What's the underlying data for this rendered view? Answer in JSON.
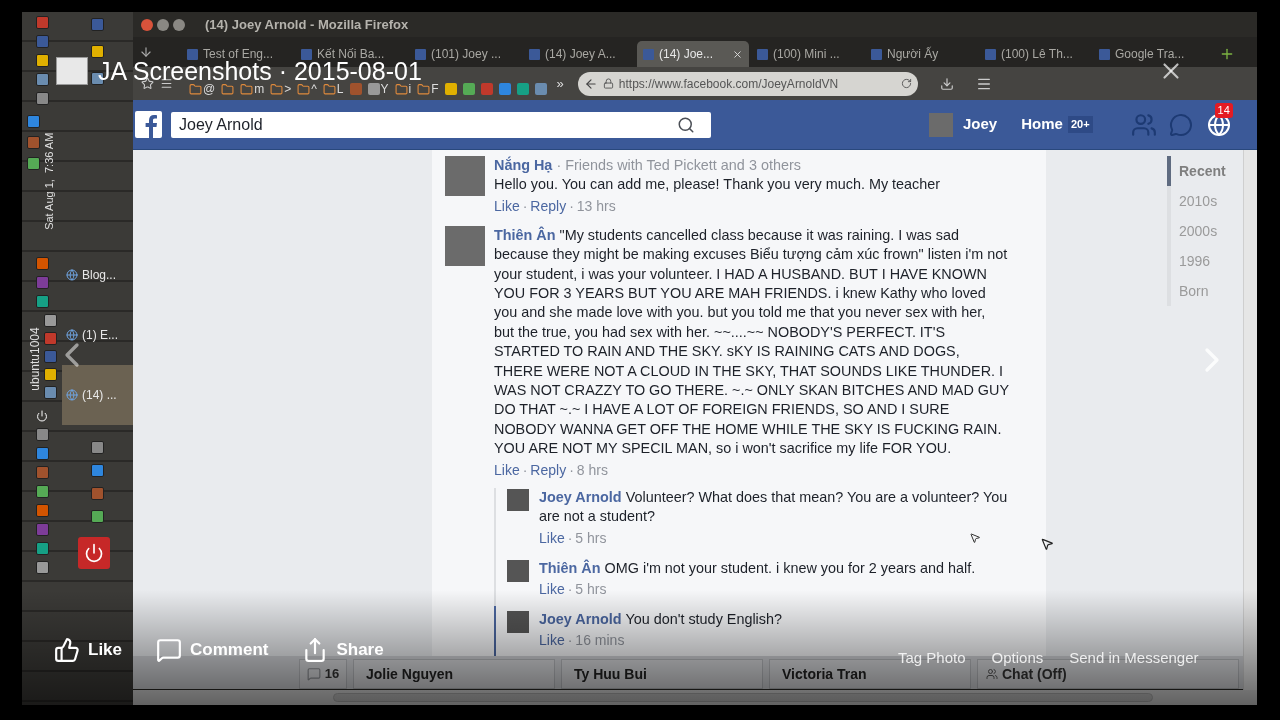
{
  "viewer": {
    "album_title": "JA Screenshots · 2015-08-01",
    "actions": [
      "Like",
      "Comment",
      "Share"
    ],
    "photo_actions": [
      "Tag Photo",
      "Options",
      "Send in Messenger"
    ]
  },
  "desktop": {
    "clock": "Sat Aug 1,  7:36 AM",
    "hostname": "ubuntu1004",
    "tasks": [
      {
        "label": "Blog...",
        "selected": false
      },
      {
        "label": "(1) E...",
        "selected": false
      },
      {
        "label": "(14) ...",
        "selected": true
      }
    ]
  },
  "browser": {
    "title": "(14) Joey Arnold - Mozilla Firefox",
    "tabs": [
      {
        "label": "Test of Eng...",
        "selected": false
      },
      {
        "label": "Kết Nối Ba...",
        "selected": false
      },
      {
        "label": "(101) Joey ...",
        "selected": false
      },
      {
        "label": "(14) Joey A...",
        "selected": false
      },
      {
        "label": "(14) Joe...",
        "selected": true
      },
      {
        "label": "(100) Mini ...",
        "selected": false
      },
      {
        "label": "Người Ấy",
        "selected": false
      },
      {
        "label": "(100) Lê Th...",
        "selected": false
      },
      {
        "label": "Google Tra...",
        "selected": false
      }
    ],
    "bookmarks": [
      {
        "kind": "folder",
        "label": "@"
      },
      {
        "kind": "folder"
      },
      {
        "kind": "folder",
        "label": "m"
      },
      {
        "kind": "folder",
        "label": ">"
      },
      {
        "kind": "folder",
        "label": "^"
      },
      {
        "kind": "folder",
        "label": "L"
      },
      {
        "kind": "site"
      },
      {
        "kind": "site",
        "label": "Y"
      },
      {
        "kind": "folder",
        "label": "i"
      },
      {
        "kind": "folder",
        "label": "F"
      },
      {
        "kind": "site"
      },
      {
        "kind": "site"
      },
      {
        "kind": "site"
      },
      {
        "kind": "site"
      },
      {
        "kind": "site"
      },
      {
        "kind": "site"
      }
    ],
    "overflow": "»",
    "url": "https://www.facebook.com/JoeyArnoldVN"
  },
  "facebook": {
    "separator": "·",
    "search_value": "Joey Arnold",
    "profile_name": "Joey",
    "home": "Home",
    "home_count": "20+",
    "notifications": "14",
    "comments": [
      {
        "author": "Nắng Hạ",
        "subtitle": "Friends with Ted Pickett and 3 others",
        "text": "Hello you. You can add me, please! Thank you very much. My teacher",
        "actions": [
          "Like",
          "Reply"
        ],
        "time": "13 hrs"
      },
      {
        "author": "Thiên Ân",
        "text": "\"My students cancelled class because it was raining. I was sad because they might be making excuses Biểu tượng cảm xúc frown\" listen i'm not your student, i was your volunteer. I HAD A HUSBAND. BUT I HAVE KNOWN YOU FOR 3 YEARS BUT YOU ARE MAH FRIENDS. i knew Kathy who loved you and she made love with you. but you told me that you never sex with her, but the true, you had sex with her. ~~....~~ NOBODY'S PERFECT. IT'S STARTED TO RAIN AND THE SKY. sKY IS RAINING CATS AND DOGS, THERE WERE NOT A CLOUD IN THE SKY, THAT SOUNDS LIKE THUNDER. I WAS NOT CRAZZY TO GO THERE. ~.~ ONLY SKAN BITCHES AND MAD GUY DO THAT ~.~ I HAVE A LOT OF FOREIGN FRIENDS, SO AND I SURE NOBODY WANNA GET OFF THE HOME WHILE THE SKY IS FUCKING RAIN. YOU ARE NOT MY SPECIL MAN, so i won't sacrifice my life FOR YOU.",
        "actions": [
          "Like",
          "Reply"
        ],
        "time": "8 hrs",
        "replies": [
          {
            "author": "Joey Arnold",
            "text": "Volunteer? What does that mean? You are a volunteer? You are not a student?",
            "actions": [
              "Like"
            ],
            "time": "5 hrs",
            "highlighted": false
          },
          {
            "author": "Thiên Ân",
            "text": "OMG i'm not your student. i knew you for 2 years and half.",
            "actions": [
              "Like"
            ],
            "time": "5 hrs",
            "highlighted": false
          },
          {
            "author": "Joey Arnold",
            "text": "You don't study English?",
            "actions": [
              "Like"
            ],
            "time": "16 mins",
            "highlighted": true
          }
        ]
      }
    ],
    "timeline": [
      {
        "label": "Recent",
        "selected": true
      },
      {
        "label": "2010s",
        "selected": false
      },
      {
        "label": "2000s",
        "selected": false
      },
      {
        "label": "1996",
        "selected": false
      },
      {
        "label": "Born",
        "selected": false
      }
    ]
  },
  "chat_bar": {
    "messages_count": "16",
    "contacts": [
      "Jolie Nguyen",
      "Ty Huu Bui",
      "Victoria Tran"
    ],
    "chat_status": "Chat (Off)"
  }
}
